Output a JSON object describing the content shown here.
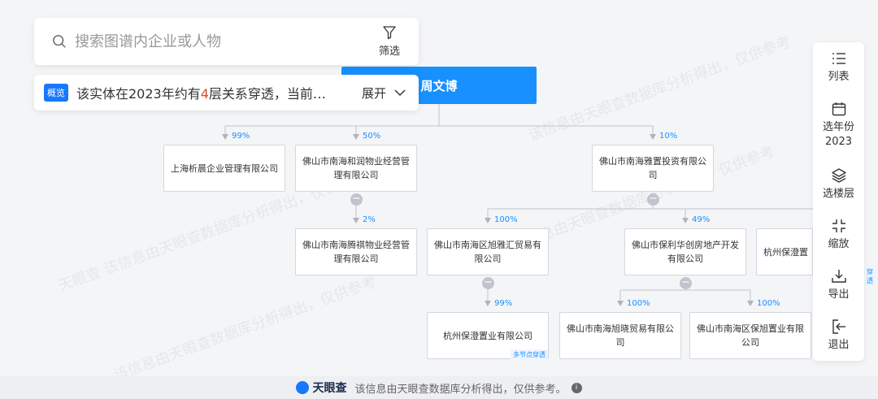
{
  "search": {
    "placeholder": "搜索图谱内企业或人物",
    "filter_label": "筛选"
  },
  "summary": {
    "badge": "概览",
    "prefix": "该实体在2023年约有",
    "count": "4",
    "suffix": "层关系穿透，当前…",
    "expand_label": "展开"
  },
  "root": {
    "name": "周文博"
  },
  "nodes": {
    "n1": {
      "name": "上海析晨企业管理有限公司",
      "pct": "99%"
    },
    "n2": {
      "name": "佛山市南海和润物业经营管理有限公司",
      "pct": "50%"
    },
    "n3": {
      "name": "佛山市南海雅置投资有限公司",
      "pct": "10%"
    },
    "n4": {
      "name": "佛山市南海腾祺物业经营管理有限公司",
      "pct": "2%"
    },
    "n5": {
      "name": "佛山市南海区旭雅汇贸易有限公司",
      "pct": "100%"
    },
    "n6": {
      "name": "佛山市保利华创房地产开发有限公司",
      "pct": "49%"
    },
    "n7": {
      "name": "杭州保澄置",
      "tag": "穿透"
    },
    "n8": {
      "name": "杭州保澄置业有限公司",
      "pct": "99%",
      "tag": "多节点穿透"
    },
    "n9": {
      "name": "佛山市南海旭晓贸易有限公司",
      "pct": "100%"
    },
    "n10": {
      "name": "佛山市南海区保旭置业有限公司",
      "pct": "100%"
    }
  },
  "collapse_symbol": "−",
  "toolbar": {
    "list": "列表",
    "year_label": "选年份",
    "year_value": "2023",
    "floor": "选楼层",
    "zoom": "缩放",
    "export": "导出",
    "exit": "退出"
  },
  "watermark": {
    "text": "该信息由天眼查数据库分析得出，仅供参考",
    "brand": "天眼查"
  },
  "footer": {
    "brand": "天眼查",
    "text": "该信息由天眼查数据库分析得出，仅供参考。",
    "info": "i"
  },
  "colors": {
    "accent": "#1890ff",
    "root_bg": "#1890ff",
    "percent": "#1890ff",
    "count_highlight": "#e34a2f"
  }
}
